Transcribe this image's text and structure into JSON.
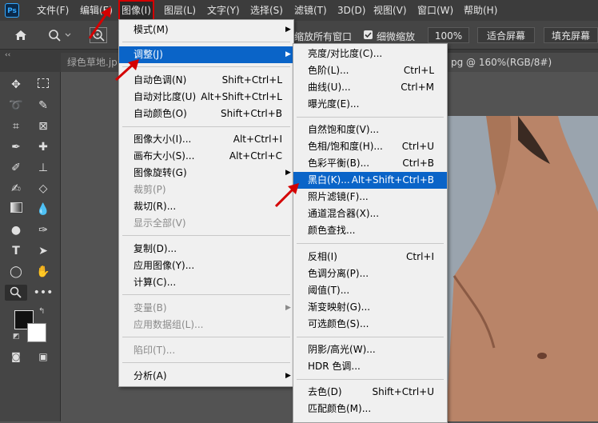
{
  "menubar": {
    "logo": "Ps",
    "items": [
      "文件(F)",
      "编辑(E)",
      "图像(I)",
      "图层(L)",
      "文字(Y)",
      "选择(S)",
      "滤镜(T)",
      "3D(D)",
      "视图(V)",
      "窗口(W)",
      "帮助(H)"
    ]
  },
  "options": {
    "scroll_all": "缩放所有窗口",
    "scrubby": "细微缩放",
    "zoom_value": "100%",
    "fit_screen": "适合屏幕",
    "fill_screen": "填充屏幕"
  },
  "tabs": {
    "left": "绿色草地.jp",
    "right": "pg @ 160%(RGB/8#)"
  },
  "image_menu": {
    "items": [
      {
        "label": "模式(M)",
        "shortcut": "",
        "submenu": true,
        "disabled": false
      },
      {
        "label": "调整(J)",
        "shortcut": "",
        "submenu": true,
        "disabled": false,
        "highlight": true
      },
      {
        "label": "自动色调(N)",
        "shortcut": "Shift+Ctrl+L",
        "disabled": false
      },
      {
        "label": "自动对比度(U)",
        "shortcut": "Alt+Shift+Ctrl+L",
        "disabled": false
      },
      {
        "label": "自动颜色(O)",
        "shortcut": "Shift+Ctrl+B",
        "disabled": false
      },
      {
        "label": "图像大小(I)...",
        "shortcut": "Alt+Ctrl+I",
        "disabled": false
      },
      {
        "label": "画布大小(S)...",
        "shortcut": "Alt+Ctrl+C",
        "disabled": false
      },
      {
        "label": "图像旋转(G)",
        "shortcut": "",
        "submenu": true,
        "disabled": false
      },
      {
        "label": "裁剪(P)",
        "shortcut": "",
        "disabled": true
      },
      {
        "label": "裁切(R)...",
        "shortcut": "",
        "disabled": false
      },
      {
        "label": "显示全部(V)",
        "shortcut": "",
        "disabled": true
      },
      {
        "label": "复制(D)...",
        "shortcut": "",
        "disabled": false
      },
      {
        "label": "应用图像(Y)...",
        "shortcut": "",
        "disabled": false
      },
      {
        "label": "计算(C)...",
        "shortcut": "",
        "disabled": false
      },
      {
        "label": "变量(B)",
        "shortcut": "",
        "submenu": true,
        "disabled": true
      },
      {
        "label": "应用数据组(L)...",
        "shortcut": "",
        "disabled": true
      },
      {
        "label": "陷印(T)...",
        "shortcut": "",
        "disabled": true
      },
      {
        "label": "分析(A)",
        "shortcut": "",
        "submenu": true,
        "disabled": false
      }
    ]
  },
  "adjust_menu": {
    "items": [
      {
        "label": "亮度/对比度(C)...",
        "shortcut": ""
      },
      {
        "label": "色阶(L)...",
        "shortcut": "Ctrl+L"
      },
      {
        "label": "曲线(U)...",
        "shortcut": "Ctrl+M"
      },
      {
        "label": "曝光度(E)...",
        "shortcut": ""
      },
      {
        "label": "自然饱和度(V)...",
        "shortcut": ""
      },
      {
        "label": "色相/饱和度(H)...",
        "shortcut": "Ctrl+U"
      },
      {
        "label": "色彩平衡(B)...",
        "shortcut": "Ctrl+B"
      },
      {
        "label": "黑白(K)...",
        "shortcut": "Alt+Shift+Ctrl+B",
        "highlight": true
      },
      {
        "label": "照片滤镜(F)...",
        "shortcut": ""
      },
      {
        "label": "通道混合器(X)...",
        "shortcut": ""
      },
      {
        "label": "颜色查找...",
        "shortcut": ""
      },
      {
        "label": "反相(I)",
        "shortcut": "Ctrl+I"
      },
      {
        "label": "色调分离(P)...",
        "shortcut": ""
      },
      {
        "label": "阈值(T)...",
        "shortcut": ""
      },
      {
        "label": "渐变映射(G)...",
        "shortcut": ""
      },
      {
        "label": "可选颜色(S)...",
        "shortcut": ""
      },
      {
        "label": "阴影/高光(W)...",
        "shortcut": ""
      },
      {
        "label": "HDR 色调...",
        "shortcut": ""
      },
      {
        "label": "去色(D)",
        "shortcut": "Shift+Ctrl+U"
      },
      {
        "label": "匹配颜色(M)...",
        "shortcut": ""
      }
    ]
  },
  "colors": {
    "highlight": "#0a64c8",
    "annotation_red": "#d40000"
  }
}
